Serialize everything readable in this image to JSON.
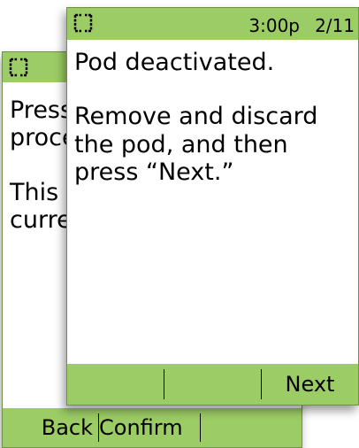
{
  "back_screen": {
    "body_paragraphs": [
      "Press to begin the procedure.",
      "This will deactivate the current pod."
    ],
    "softkeys": {
      "left": "Back",
      "middle": "Confirm",
      "right": ""
    }
  },
  "front_screen": {
    "status_time": "3:00p",
    "status_page": "2/11",
    "body_paragraphs": [
      "Pod deactivated.",
      "Remove and discard the pod, and then press “Next.”"
    ],
    "softkeys": {
      "left": "",
      "middle": "",
      "right": "Next"
    }
  },
  "colors": {
    "status_bar": "#9ccc65",
    "screen": "#ffffff"
  },
  "icons": {
    "status": "pod-status-icon"
  }
}
